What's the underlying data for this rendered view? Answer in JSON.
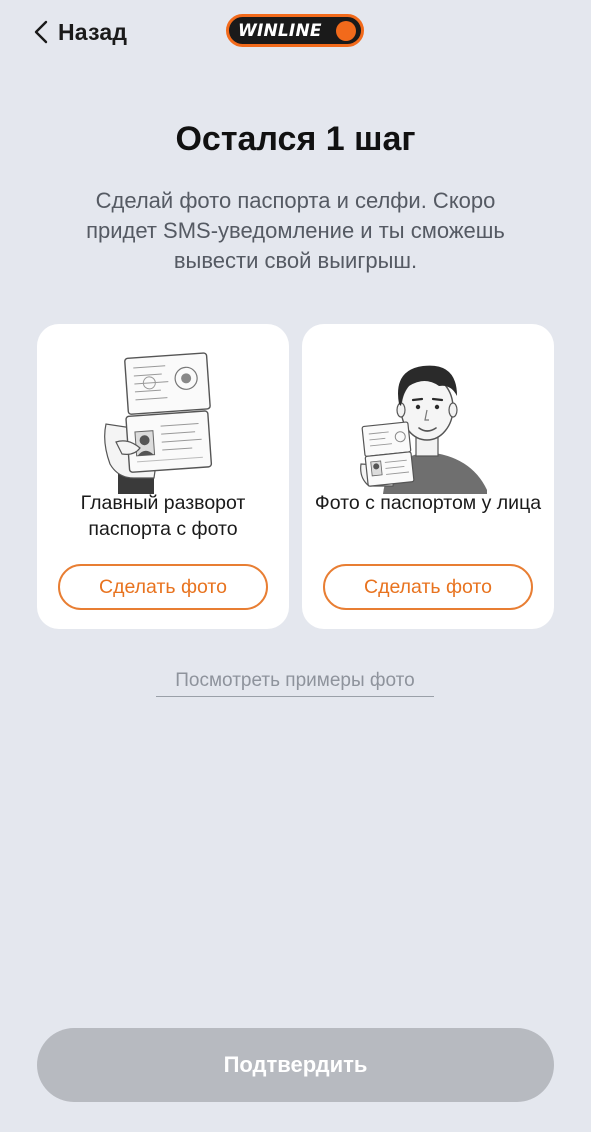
{
  "header": {
    "back_label": "Назад",
    "logo_text": "WINLINE"
  },
  "main": {
    "title": "Остался 1 шаг",
    "subtitle": "Сделай фото паспорта и селфи. Скоро придет SMS-уведомление и ты сможешь вывести свой выигрыш."
  },
  "cards": [
    {
      "illustration": "passport-in-hand-illustration",
      "label": "Главный разворот паспорта с фото",
      "button_label": "Сделать фото"
    },
    {
      "illustration": "selfie-with-passport-illustration",
      "label": "Фото с паспортом у лица",
      "button_label": "Сделать фото"
    }
  ],
  "examples_link": "Посмотреть примеры фото",
  "confirm_button": "Подтвердить",
  "colors": {
    "background": "#e4e7ee",
    "accent": "#f26a1b",
    "button_disabled": "#b7bac0"
  }
}
